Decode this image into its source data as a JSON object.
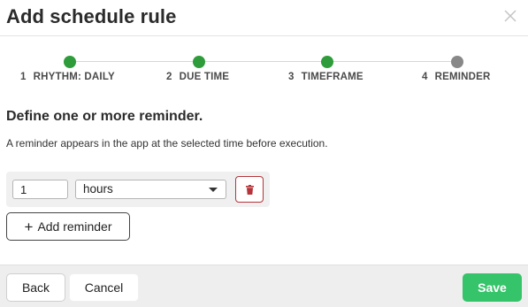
{
  "dialog": {
    "title": "Add schedule rule",
    "close_icon": "close-icon"
  },
  "stepper": {
    "steps": [
      {
        "number": "1",
        "label": "RHYTHM: DAILY",
        "status": "completed",
        "color": "#2e9c3b"
      },
      {
        "number": "2",
        "label": "DUE TIME",
        "status": "completed",
        "color": "#2e9c3b"
      },
      {
        "number": "3",
        "label": "TIMEFRAME",
        "status": "completed",
        "color": "#2e9c3b"
      },
      {
        "number": "4",
        "label": "REMINDER",
        "status": "current",
        "color": "#888888"
      }
    ]
  },
  "main": {
    "heading": "Define one or more reminder.",
    "description": "A reminder appears in the app at the selected time before execution.",
    "reminders": [
      {
        "amount": "1",
        "unit": "hours",
        "delete_icon": "trash-icon"
      }
    ],
    "add_reminder_label": "Add reminder",
    "add_reminder_icon": "plus-icon"
  },
  "footer": {
    "back_label": "Back",
    "cancel_label": "Cancel",
    "save_label": "Save"
  },
  "colors": {
    "accent_green": "#35c46a",
    "step_complete": "#2e9c3b",
    "step_current": "#888888",
    "danger": "#b5343a"
  }
}
